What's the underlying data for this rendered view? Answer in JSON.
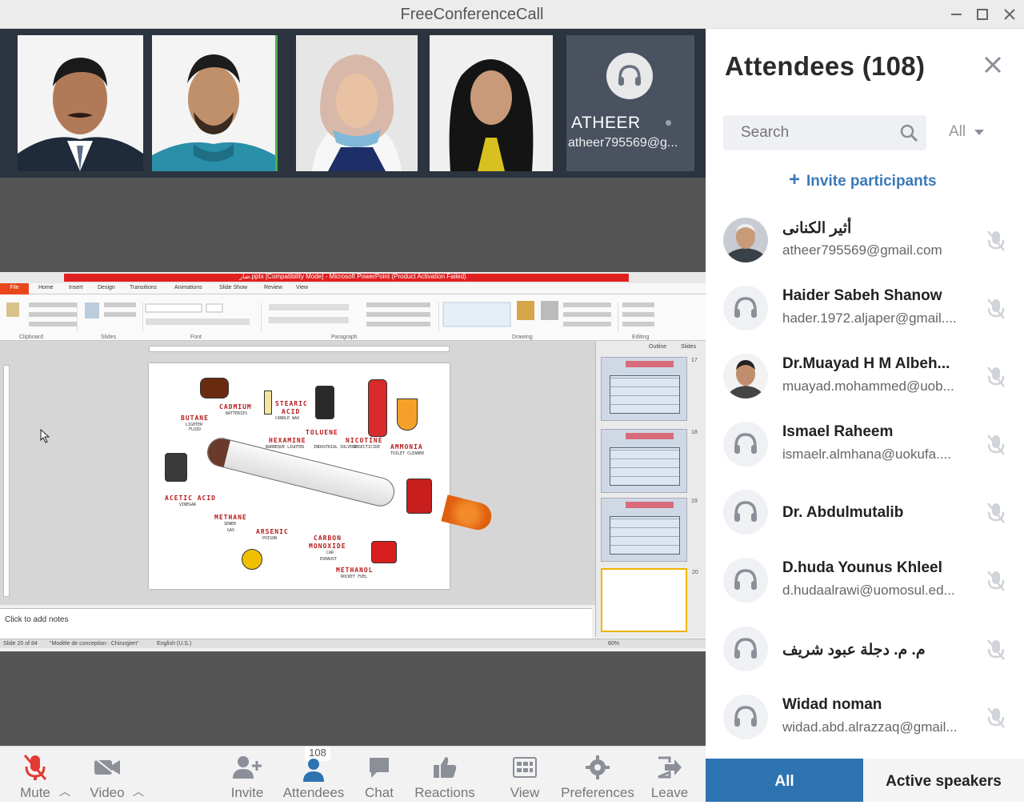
{
  "window": {
    "title": "FreeConferenceCall"
  },
  "strip": {
    "tiles": [
      {
        "kind": "photo"
      },
      {
        "kind": "photo"
      },
      {
        "kind": "photo"
      },
      {
        "kind": "photo"
      },
      {
        "kind": "audio",
        "name": "ATHEER",
        "email": "atheer795569@g..."
      }
    ]
  },
  "presentation": {
    "title_bar": "ضار.pptx [Compatibility Mode] - Microsoft PowerPoint (Product Activation Failed)",
    "tabs": [
      "File",
      "Home",
      "Insert",
      "Design",
      "Transitions",
      "Animations",
      "Slide Show",
      "Review",
      "View"
    ],
    "groups": [
      "Clipboard",
      "Slides",
      "Font",
      "Paragraph",
      "Drawing",
      "Editing"
    ],
    "panel_tabs": [
      "Outline",
      "Slides"
    ],
    "slide_numbers": [
      "17",
      "18",
      "19",
      "20"
    ],
    "notes_placeholder": "Click to add notes",
    "status": {
      "slide": "Slide 20 of 84",
      "theme": "\"Modèle de conception : Chirurgien\"",
      "lang": "English (U.S.)",
      "zoom": "60%"
    },
    "slide_labels": [
      "CADMIUM",
      "BATTERIES",
      "STEARIC",
      "ACID",
      "CANDLE WAX",
      "BUTANE",
      "LIGHTER",
      "FLUID",
      "TOLUENE",
      "HEXAMINE",
      "NICOTINE",
      "INDUSTRIAL SOLVENT",
      "INSECTICIDE",
      "AMMONIA",
      "TOILET CLEANER",
      "BARBEQUE LIGHTER",
      "ACETIC ACID",
      "VINEGAR",
      "METHANE",
      "SEWER",
      "GAS",
      "ARSENIC",
      "POISON",
      "CARBON",
      "MONOXIDE",
      "CAR",
      "EXHAUST",
      "METHANOL",
      "ROCKET FUEL"
    ]
  },
  "toolbar": {
    "mute": "Mute",
    "video": "Video",
    "invite": "Invite",
    "attendees": "Attendees",
    "attendees_count": "108",
    "chat": "Chat",
    "reactions": "Reactions",
    "view": "View",
    "preferences": "Preferences",
    "leave": "Leave",
    "accent": "#e53935"
  },
  "panel": {
    "title": "Attendees (108)",
    "search_placeholder": "Search",
    "filter": "All",
    "invite": "Invite participants",
    "attendees": [
      {
        "name": "أثير الكنانى",
        "email": "atheer795569@gmail.com",
        "avatar": "photo"
      },
      {
        "name": "Haider Sabeh Shanow",
        "email": "hader.1972.aljaper@gmail....",
        "avatar": "headset-icon"
      },
      {
        "name": "Dr.Muayad H M Albeh...",
        "email": "muayad.mohammed@uob...",
        "avatar": "photo"
      },
      {
        "name": "Ismael Raheem",
        "email": "ismaelr.almhana@uokufa....",
        "avatar": "headset-icon"
      },
      {
        "name": "Dr. Abdulmutalib",
        "email": "",
        "avatar": "headset-icon"
      },
      {
        "name": "D.huda Younus Khleel",
        "email": "d.hudaalrawi@uomosul.ed...",
        "avatar": "headset-icon"
      },
      {
        "name": "م. م. دجلة عبود شريف",
        "email": "",
        "avatar": "headset-icon"
      },
      {
        "name": "Widad noman",
        "email": "widad.abd.alrazzaq@gmail...",
        "avatar": "headset-icon"
      }
    ],
    "tabs": {
      "all": "All",
      "active": "Active speakers"
    },
    "accent": "#2e73b1"
  }
}
